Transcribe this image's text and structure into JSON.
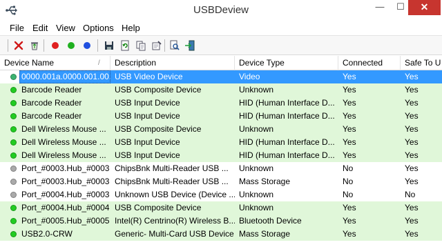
{
  "window": {
    "title": "USBDeview",
    "minimize_glyph": "—",
    "maximize_glyph": "☐",
    "close_glyph": "✕"
  },
  "menu": [
    "File",
    "Edit",
    "View",
    "Options",
    "Help"
  ],
  "toolbar": {
    "buttons": [
      {
        "name": "uninstall-icon"
      },
      {
        "name": "recycle-icon"
      },
      {
        "name": "disable-red-dot-icon",
        "color": "#e02020"
      },
      {
        "name": "enable-green-dot-icon",
        "color": "#20b020"
      },
      {
        "name": "blue-dot-icon",
        "color": "#2050e0"
      },
      {
        "name": "save-icon"
      },
      {
        "name": "refresh-icon"
      },
      {
        "name": "copy-icon"
      },
      {
        "name": "properties-icon"
      },
      {
        "name": "find-icon"
      },
      {
        "name": "exit-icon"
      }
    ]
  },
  "columns": [
    "Device Name",
    "Description",
    "Device Type",
    "Connected",
    "Safe To U"
  ],
  "sort_indicator": "/",
  "colors": {
    "connected_row": "#e0f7d9",
    "selection": "#3399ff",
    "dot_connected": "#22cc22",
    "dot_disconnected": "#aaaaaa",
    "dot_selected": "#3cb371"
  },
  "rows": [
    {
      "name": "0000.001a.0000.001.00...",
      "description": "USB Video Device",
      "type": "Video",
      "connected": "Yes",
      "safe": "Yes",
      "status": "selected"
    },
    {
      "name": "Barcode Reader",
      "description": "USB Composite Device",
      "type": "Unknown",
      "connected": "Yes",
      "safe": "Yes",
      "status": "connected"
    },
    {
      "name": "Barcode Reader",
      "description": "USB Input Device",
      "type": "HID (Human Interface D...",
      "connected": "Yes",
      "safe": "Yes",
      "status": "connected"
    },
    {
      "name": "Barcode Reader",
      "description": "USB Input Device",
      "type": "HID (Human Interface D...",
      "connected": "Yes",
      "safe": "Yes",
      "status": "connected"
    },
    {
      "name": "Dell Wireless Mouse ...",
      "description": "USB Composite Device",
      "type": "Unknown",
      "connected": "Yes",
      "safe": "Yes",
      "status": "connected"
    },
    {
      "name": "Dell Wireless Mouse ...",
      "description": "USB Input Device",
      "type": "HID (Human Interface D...",
      "connected": "Yes",
      "safe": "Yes",
      "status": "connected"
    },
    {
      "name": "Dell Wireless Mouse ...",
      "description": "USB Input Device",
      "type": "HID (Human Interface D...",
      "connected": "Yes",
      "safe": "Yes",
      "status": "connected"
    },
    {
      "name": "Port_#0003.Hub_#0003",
      "description": "ChipsBnk  Multi-Reader USB ...",
      "type": "Unknown",
      "connected": "No",
      "safe": "Yes",
      "status": "disconnected"
    },
    {
      "name": "Port_#0003.Hub_#0003",
      "description": "ChipsBnk  Multi-Reader USB ...",
      "type": "Mass Storage",
      "connected": "No",
      "safe": "Yes",
      "status": "disconnected"
    },
    {
      "name": "Port_#0004.Hub_#0003",
      "description": "Unknown USB Device (Device ...",
      "type": "Unknown",
      "connected": "No",
      "safe": "No",
      "status": "disconnected"
    },
    {
      "name": "Port_#0004.Hub_#0004",
      "description": "USB Composite Device",
      "type": "Unknown",
      "connected": "Yes",
      "safe": "Yes",
      "status": "connected"
    },
    {
      "name": "Port_#0005.Hub_#0005",
      "description": "Intel(R) Centrino(R) Wireless B...",
      "type": "Bluetooth Device",
      "connected": "Yes",
      "safe": "Yes",
      "status": "connected"
    },
    {
      "name": "USB2.0-CRW",
      "description": "Generic- Multi-Card USB Device",
      "type": "Mass Storage",
      "connected": "Yes",
      "safe": "Yes",
      "status": "connected"
    }
  ]
}
